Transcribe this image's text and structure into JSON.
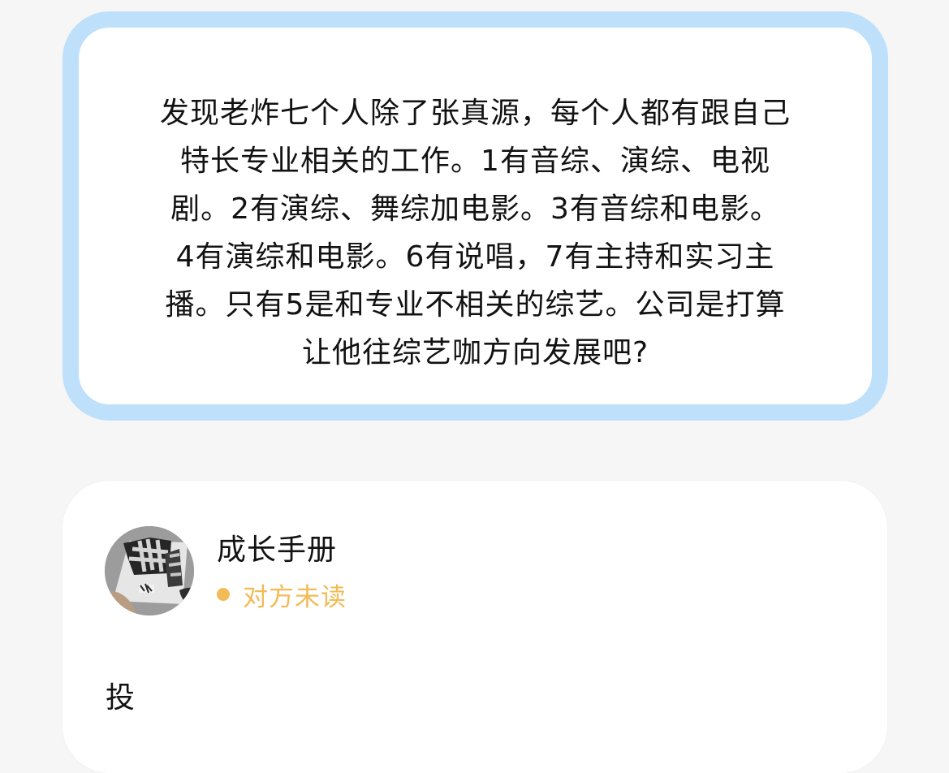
{
  "question_card": {
    "text": "发现老炸七个人除了张真源，每个人都有跟自己特长专业相关的工作。1有音综、演综、电视剧。2有演综、舞综加电影。3有音综和电影。4有演综和电影。6有说唱，7有主持和实习主播。只有5是和专业不相关的综艺。公司是打算让他往综艺咖方向发展吧?",
    "lines": [
      "发现老炸七个人除了张真源，每个人都有跟自己",
      "特长专业相关的工作。1有音综、演综、电视",
      "剧。2有演综、舞综加电影。3有音综和电影。",
      "4有演综和电影。6有说唱，7有主持和实习主",
      "播。只有5是和专业不相关的综艺。公司是打算",
      "让他往综艺咖方向发展吧?"
    ]
  },
  "answer_card": {
    "sender_name": "成长手册",
    "avatar_icon": "book-avatar-icon",
    "read_status": "对方未读",
    "preview_text": "投"
  },
  "colors": {
    "question_border": "#bfe0fb",
    "status_color": "#f2bb56",
    "background": "#f6f6f6"
  }
}
